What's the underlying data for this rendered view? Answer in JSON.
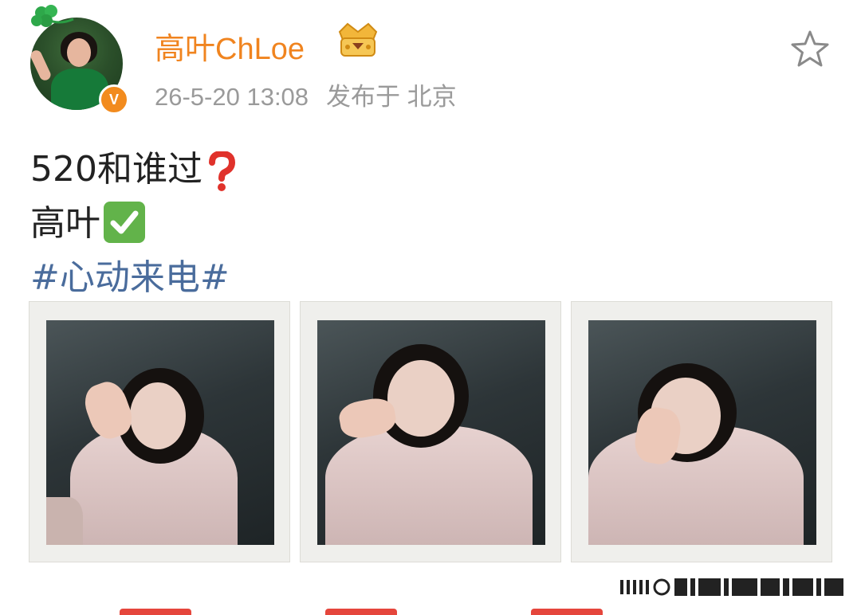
{
  "user": {
    "name": "高叶ChLoe",
    "verified_label": "V"
  },
  "post": {
    "date": "26-5-20 13:08",
    "location": "发布于 北京",
    "line1": "520和谁过",
    "line2": "高叶",
    "hashtag": "#心动来电#"
  },
  "icons": {
    "star": "star-outline-icon",
    "question": "red-question-mark-icon",
    "check": "green-check-mark-icon",
    "vip": "vip-crown-badge-icon",
    "clover": "clover-icon"
  },
  "colors": {
    "username": "#f0841f",
    "hashtag": "#4a6c9c",
    "meta": "#9a9a9a",
    "verified": "#f28b1e"
  },
  "photos": [
    {
      "name": "polaroid-1"
    },
    {
      "name": "polaroid-2"
    },
    {
      "name": "polaroid-3"
    }
  ]
}
